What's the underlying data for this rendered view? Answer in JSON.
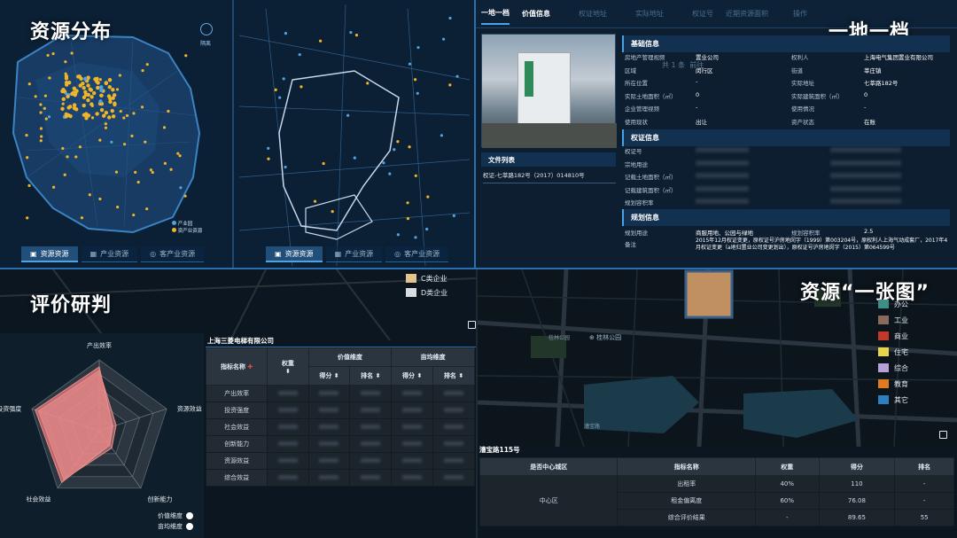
{
  "q1": {
    "title": "资源分布",
    "left_map": {
      "tabs": [
        "资源资源",
        "产业资源",
        "客产业资源"
      ],
      "legend": [
        "产业园",
        "资产业资源"
      ],
      "compass_label": "隔离"
    },
    "right_map": {
      "tabs": [
        "资源资源",
        "产业资源",
        "客产业资源"
      ]
    }
  },
  "q2": {
    "title": "一地一档",
    "tabs": [
      "一地一档",
      "价值信息",
      "权证地址",
      "实际地址",
      "权证号",
      "近期资源面积",
      "操作"
    ],
    "overlay_text": [
      "共 1 条",
      "前往"
    ],
    "file_list": {
      "title": "文件列表",
      "item": "权证-七莘路182号（2017）014810号"
    },
    "basic_info": {
      "title": "基础信息",
      "rows": [
        {
          "k": "房地产管理视频",
          "v": "置业公司",
          "k2": "权利人",
          "v2": "上海电气集团置业有限公司"
        },
        {
          "k": "区域",
          "v": "闵行区",
          "k2": "街道",
          "v2": "莘庄镇"
        },
        {
          "k": "所在位置",
          "v": "-",
          "k2": "实际地址",
          "v2": "七莘路182号"
        },
        {
          "k": "实际土地面积（㎡）",
          "v": "0",
          "k2": "实际建筑面积（㎡）",
          "v2": "0"
        },
        {
          "k": "企业管理视频",
          "v": "-",
          "k2": "使用情况",
          "v2": "-"
        },
        {
          "k": "使用现状",
          "v": "出让",
          "k2": "资产状态",
          "v2": "在账"
        }
      ]
    },
    "right_info": {
      "title": "权证信息",
      "rows": [
        "权证号",
        "宗地用途",
        "记载土地面积（㎡）",
        "记载建筑面积（㎡）",
        "规划容积率"
      ]
    },
    "plan_info": {
      "title": "规划信息",
      "rows": [
        {
          "k": "规划用途",
          "v": "商服用地、公园与绿地",
          "k2": "规划容积率",
          "v2": "2.5"
        }
      ],
      "remark_label": "备注",
      "remark": "2015年12月权证变更，原权证号沪房地闵字（1999）第003204号，原权利人上海气动成套厂，2017年4月权证变更（a地归置业公司变更划出），原权证号沪房地闵字（2015）第064599号"
    }
  },
  "q3": {
    "title": "评价研判",
    "legend_top": [
      "C类企业",
      "D类企业"
    ],
    "radar_labels": [
      "产出效率",
      "资源效益",
      "创新能力",
      "社会效益",
      "投资强度"
    ],
    "radar_series": [
      {
        "name": "价值维度",
        "values": [
          0.9,
          0.2,
          0.25,
          0.9,
          0.95
        ]
      },
      {
        "name": "亩均维度",
        "values": [
          0.85,
          0.25,
          0.3,
          0.85,
          0.9
        ]
      }
    ],
    "radar_legend": [
      "价值维度",
      "亩均维度"
    ],
    "company": "上海三菱电梯有限公司",
    "table": {
      "h_index": "指标名称",
      "h_weight": "权重",
      "h_value": "价值维度",
      "h_mu": "亩均维度",
      "h_score": "得分",
      "h_rank": "排名",
      "rows": [
        "产出效率",
        "投资强度",
        "社会效益",
        "创新能力",
        "资源效益",
        "综合效益"
      ]
    }
  },
  "q4": {
    "title": "资源“一张图”",
    "legend": [
      {
        "name": "办公",
        "color": "#3f8f86"
      },
      {
        "name": "工业",
        "color": "#8a6a5a"
      },
      {
        "name": "商业",
        "color": "#c0392b"
      },
      {
        "name": "住宅",
        "color": "#e8d44d"
      },
      {
        "name": "综合",
        "color": "#b6a0d8"
      },
      {
        "name": "教育",
        "color": "#e07b22"
      },
      {
        "name": "其它",
        "color": "#2f7fbf"
      }
    ],
    "map_labels": [
      "桂林公园",
      "桂林公园",
      "漕宝路"
    ],
    "address": "漕宝路115号",
    "table": {
      "headers": [
        "是否中心城区",
        "指标名称",
        "权重",
        "得分",
        "排名"
      ],
      "group": "中心区",
      "rows": [
        [
          "出租率",
          "40%",
          "110",
          "-"
        ],
        [
          "租金偏离度",
          "60%",
          "76.08",
          "-"
        ],
        [
          "综合评价结果",
          "-",
          "89.65",
          "55"
        ]
      ]
    }
  }
}
